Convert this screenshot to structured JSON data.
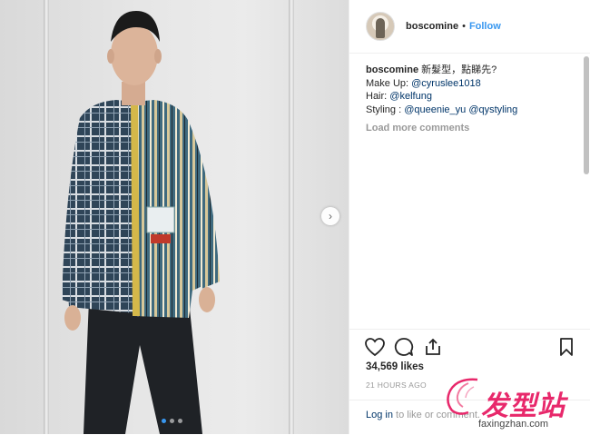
{
  "post": {
    "username": "boscomine",
    "separator": "•",
    "follow_label": "Follow",
    "caption": {
      "username": "boscomine",
      "text": "新髮型，點睇先?",
      "makeup_label": "Make Up:",
      "makeup_handle": "@cyruslee1018",
      "hair_label": "Hair:",
      "hair_handle": "@kelfung",
      "styling_label": "Styling :",
      "styling_handle_1": "@queenie_yu",
      "styling_handle_2": "@qystyling"
    },
    "load_more_label": "Load more comments",
    "likes": "34,569 likes",
    "time": "21 HOURS AGO",
    "login_link": "Log in",
    "login_rest": "to like or comment."
  },
  "carousel": {
    "next_icon": "chevron-right-icon",
    "dot_count": 3,
    "active_index": 0
  },
  "icons": {
    "like": "heart-icon",
    "comment": "comment-icon",
    "share": "share-icon",
    "save": "bookmark-icon"
  },
  "watermark": {
    "brand_cn": "发型站",
    "url": "faxingzhan.com"
  },
  "colors": {
    "link_blue": "#3897f0",
    "handle_blue": "#003569",
    "muted_gray": "#999999",
    "watermark_pink": "#e8286b"
  }
}
